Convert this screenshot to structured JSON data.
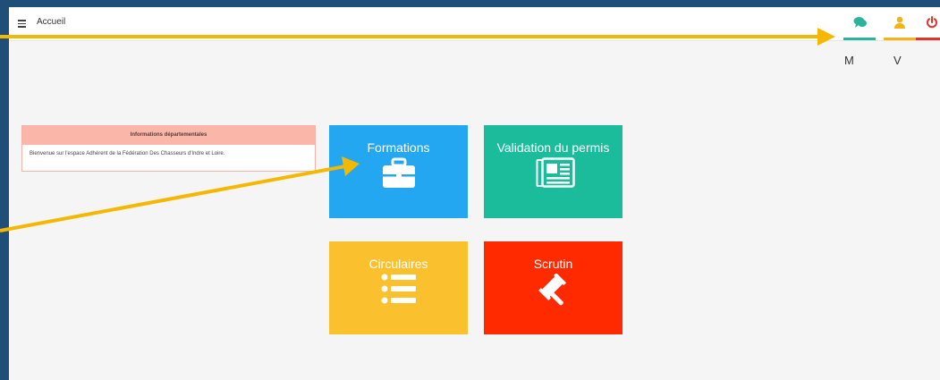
{
  "header": {
    "title": "Accueil",
    "menu_icon": "hamburger-icon",
    "buttons": [
      {
        "icon": "chat-icon",
        "color": "#2bb39b"
      },
      {
        "icon": "user-icon",
        "color": "#f5b31a"
      },
      {
        "icon": "power-icon",
        "color": "#e2332b"
      }
    ]
  },
  "sub_labels": {
    "left": "M",
    "right": "V"
  },
  "info": {
    "title": "Informations départementales",
    "body": "Bienvenue sur l'espace Adhérent de la Fédération Des Chasseurs d'Indre et Loire."
  },
  "tiles": [
    {
      "label": "Formations",
      "icon": "briefcase-icon",
      "color": "#22a7f0"
    },
    {
      "label": "Validation du permis",
      "icon": "newspaper-icon",
      "color": "#1abc9c"
    },
    {
      "label": "Circulaires",
      "icon": "list-icon",
      "color": "#fbc02d"
    },
    {
      "label": "Scrutin",
      "icon": "gavel-icon",
      "color": "#ff2a00"
    }
  ],
  "annotation_color": "#f5b800"
}
